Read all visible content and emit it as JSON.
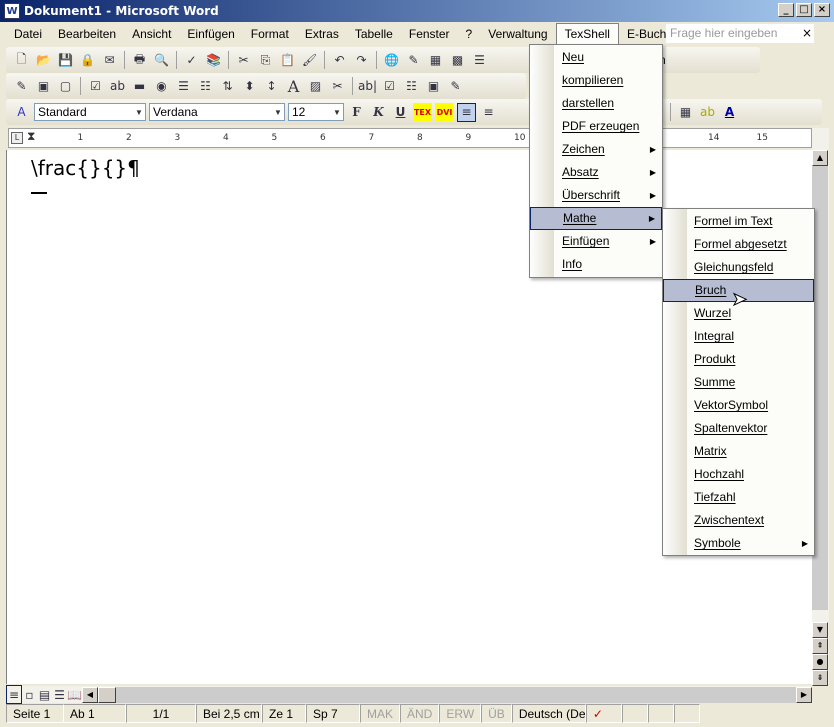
{
  "window": {
    "title": "Dokument1 - Microsoft Word",
    "controls": [
      "_",
      "□",
      "×"
    ]
  },
  "menubar": {
    "items": [
      "Datei",
      "Bearbeiten",
      "Ansicht",
      "Einfügen",
      "Format",
      "Extras",
      "Tabelle",
      "Fenster",
      "?",
      "Verwaltung",
      "TexShell",
      "E-Buch"
    ],
    "ask_placeholder": "Frage hier eingeben",
    "close": "×"
  },
  "toolbar1": {
    "icons": [
      "new-icon",
      "open-icon",
      "save-icon",
      "permission-icon",
      "email-icon",
      "print-icon",
      "print-preview-icon",
      "spelling-icon",
      "research-icon",
      "cut-icon",
      "copy-icon",
      "paste-icon",
      "format-painter-icon",
      "undo-icon",
      "redo-icon",
      "hyperlink-icon",
      "tables-borders-icon",
      "insert-table-icon",
      "insert-excel-icon",
      "columns-icon",
      "help-icon"
    ],
    "read_label": "Lesen"
  },
  "toolbar3": {
    "style": "Standard",
    "font": "Verdana",
    "size": "12",
    "bold": "F",
    "italic": "K",
    "underline": "U",
    "tex": "TEX",
    "dvi": "DVI"
  },
  "ruler": {
    "ticks": [
      "1",
      "2",
      "3",
      "4",
      "5",
      "6",
      "7",
      "8",
      "9",
      "10",
      "14",
      "15"
    ]
  },
  "document": {
    "text": "\\frac{}{}¶"
  },
  "texshell_menu": {
    "items": [
      {
        "label": "Neu"
      },
      {
        "label": "kompilieren"
      },
      {
        "label": "darstellen"
      },
      {
        "label": "PDF erzeugen"
      },
      {
        "label": "Zeichen",
        "submenu": true
      },
      {
        "label": "Absatz",
        "submenu": true
      },
      {
        "label": "Überschrift",
        "submenu": true
      },
      {
        "label": "Mathe",
        "submenu": true,
        "highlighted": true
      },
      {
        "label": "Einfügen",
        "submenu": true
      },
      {
        "label": "Info"
      }
    ]
  },
  "mathe_submenu": {
    "items": [
      {
        "label": "Formel im Text"
      },
      {
        "label": "Formel abgesetzt"
      },
      {
        "label": "Gleichungsfeld"
      },
      {
        "label": "Bruch",
        "highlighted": true
      },
      {
        "label": "Wurzel"
      },
      {
        "label": "Integral"
      },
      {
        "label": "Produkt"
      },
      {
        "label": "Summe"
      },
      {
        "label": "VektorSymbol"
      },
      {
        "label": "Spaltenvektor"
      },
      {
        "label": "Matrix"
      },
      {
        "label": "Hochzahl"
      },
      {
        "label": "Tiefzahl"
      },
      {
        "label": "Zwischentext"
      },
      {
        "label": "Symbole",
        "submenu": true
      }
    ]
  },
  "statusbar": {
    "page": "Seite 1",
    "section": "Ab 1",
    "pages": "1/1",
    "at": "Bei 2,5 cm",
    "line": "Ze 1",
    "col": "Sp 7",
    "mak": "MAK",
    "and": "ÄND",
    "erw": "ERW",
    "ub": "ÜB",
    "language": "Deutsch (De"
  },
  "colors": {
    "menu_highlight": "#b6bdd2",
    "title_start": "#0a246a",
    "title_end": "#a6caf0"
  }
}
